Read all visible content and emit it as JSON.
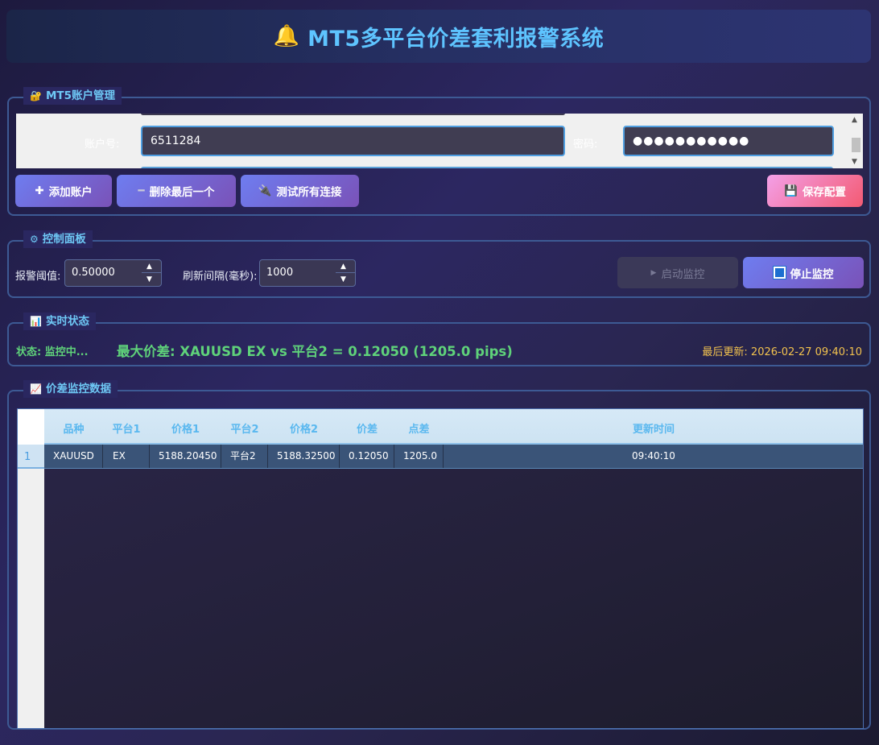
{
  "header": {
    "title": "MT5多平台价差套利报警系统",
    "icon": "bell-icon"
  },
  "account": {
    "group_title": "MT5账户管理",
    "account_label": "账户号:",
    "account_value": "6511284",
    "password_label": "密码:",
    "password_value": "●●●●●●●●●●●",
    "add_label": "添加账户",
    "delete_label": "删除最后一个",
    "test_label": "测试所有连接",
    "save_label": "保存配置"
  },
  "control": {
    "group_title": "控制面板",
    "threshold_label": "报警阈值:",
    "threshold_value": "0.50000",
    "interval_label": "刷新间隔(毫秒):",
    "interval_value": "1000",
    "start_label": "启动监控",
    "stop_label": "停止监控"
  },
  "status": {
    "group_title": "实时状态",
    "state": "状态: 监控中...",
    "max_spread": "最大价差: XAUUSD EX vs 平台2 = 0.12050 (1205.0 pips)",
    "last_update": "最后更新: 2026-02-27 09:40:10"
  },
  "table": {
    "group_title": "价差监控数据",
    "columns": [
      "品种",
      "平台1",
      "价格1",
      "平台2",
      "价格2",
      "价差",
      "点差",
      "更新时间"
    ],
    "rows": [
      {
        "num": "1",
        "cells": [
          "XAUUSD",
          "EX",
          "5188.20450",
          "平台2",
          "5188.32500",
          "0.12050",
          "1205.0",
          "09:40:10"
        ]
      }
    ]
  },
  "colors": {
    "accent": "#5ec4ff",
    "status_green": "#5fd27a",
    "update_yellow": "#f2c24e"
  }
}
